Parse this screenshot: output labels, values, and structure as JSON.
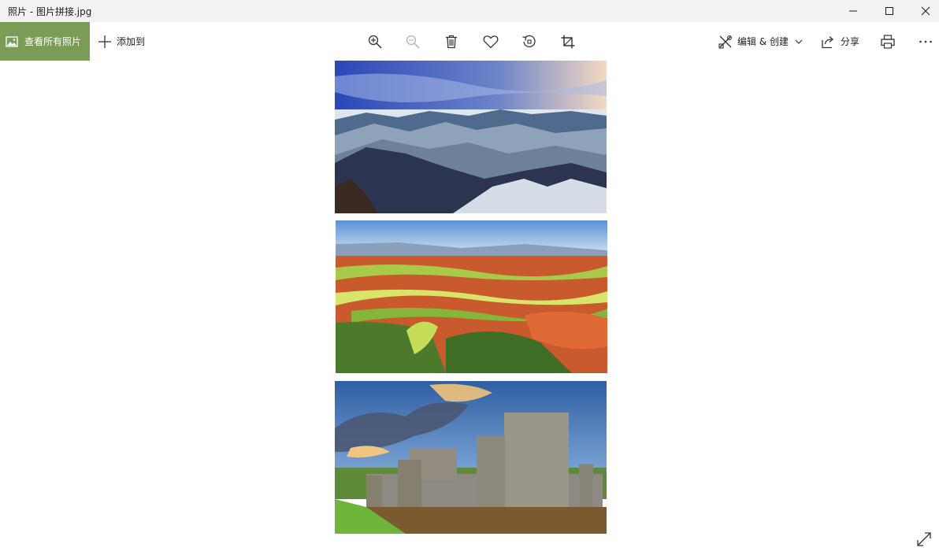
{
  "window": {
    "title": "照片 - 图片拼接.jpg"
  },
  "toolbar": {
    "view_all_label": "查看所有照片",
    "add_to_label": "添加到",
    "edit_create_label": "编辑 & 创建",
    "share_label": "分享",
    "icons": [
      "zoom-in-icon",
      "zoom-out-icon",
      "delete-icon",
      "heart-icon",
      "rotate-icon",
      "crop-icon",
      "print-icon",
      "more-icon"
    ]
  },
  "colors": {
    "accent": "#7a9c57",
    "titlebar": "#f2f2f2"
  },
  "images": [
    {
      "subject": "misty mountain range under blue sky"
    },
    {
      "subject": "colorful terraced farmland fields"
    },
    {
      "subject": "stone castle with moat at sunset"
    }
  ]
}
